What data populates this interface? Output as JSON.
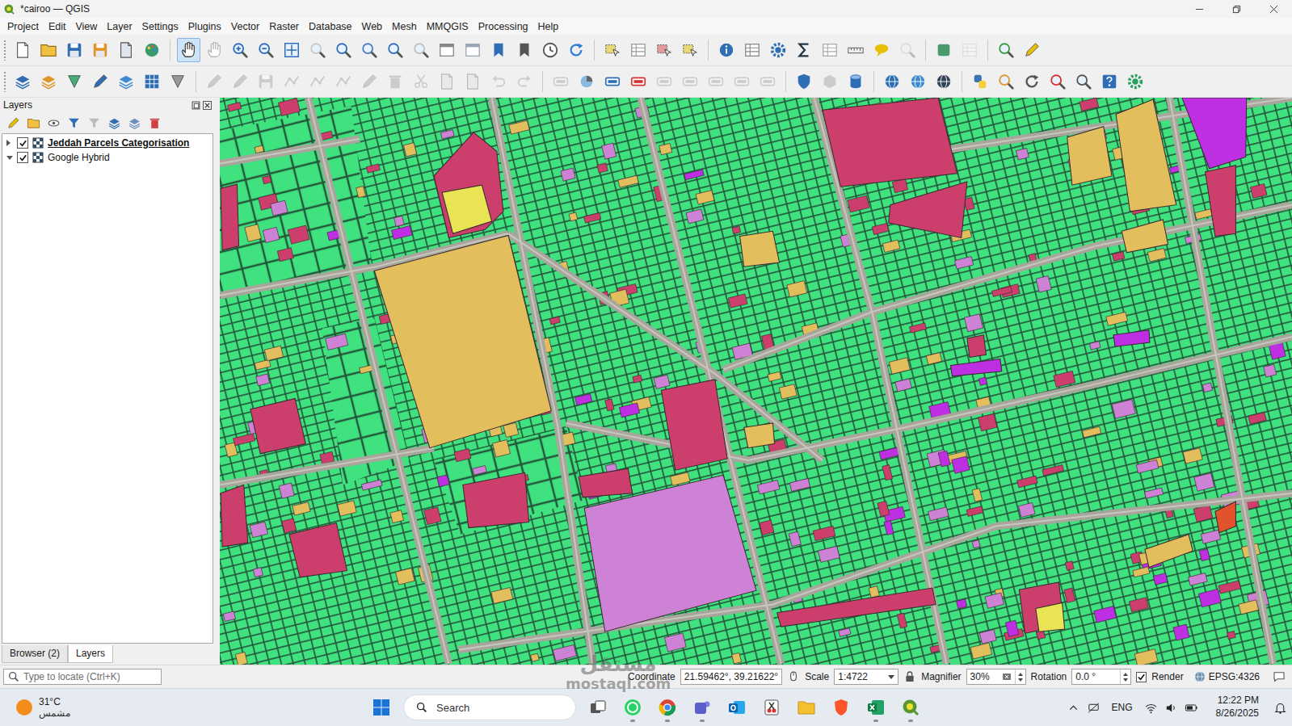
{
  "window": {
    "title": "*cairoo — QGIS"
  },
  "menu": [
    "Project",
    "Edit",
    "View",
    "Layer",
    "Settings",
    "Plugins",
    "Vector",
    "Raster",
    "Database",
    "Web",
    "Mesh",
    "MMQGIS",
    "Processing",
    "Help"
  ],
  "toolbars": [
    {
      "groups": [
        [
          {
            "kind": "new",
            "selected": false,
            "disabled": false
          },
          {
            "kind": "open",
            "selected": false,
            "disabled": false
          },
          {
            "kind": "save",
            "selected": false,
            "disabled": false
          },
          {
            "kind": "save-as",
            "selected": false,
            "disabled": false
          },
          {
            "kind": "layout",
            "selected": false,
            "disabled": false
          },
          {
            "kind": "style",
            "selected": false,
            "disabled": false
          }
        ],
        [
          {
            "kind": "pan",
            "selected": true,
            "disabled": false
          },
          {
            "kind": "pan-selection",
            "selected": false,
            "disabled": false
          },
          {
            "kind": "zoom-in",
            "selected": false,
            "disabled": false
          },
          {
            "kind": "zoom-out",
            "selected": false,
            "disabled": false
          },
          {
            "kind": "full-extent",
            "selected": false,
            "disabled": false
          },
          {
            "kind": "zoom-selection",
            "selected": false,
            "disabled": false
          },
          {
            "kind": "zoom-layer",
            "selected": false,
            "disabled": false
          },
          {
            "kind": "zoom-native",
            "selected": false,
            "disabled": false
          },
          {
            "kind": "zoom-last",
            "selected": false,
            "disabled": false
          },
          {
            "kind": "zoom-next",
            "selected": false,
            "disabled": false
          },
          {
            "kind": "map-view",
            "selected": false,
            "disabled": false
          },
          {
            "kind": "view-3d",
            "selected": false,
            "disabled": false
          },
          {
            "kind": "bookmark",
            "selected": false,
            "disabled": false
          },
          {
            "kind": "bookmarks",
            "selected": false,
            "disabled": false
          },
          {
            "kind": "temporal",
            "selected": false,
            "disabled": false
          },
          {
            "kind": "refresh",
            "selected": false,
            "disabled": false
          }
        ],
        [
          {
            "kind": "select",
            "selected": false,
            "disabled": false
          },
          {
            "kind": "select-value",
            "selected": false,
            "disabled": false
          },
          {
            "kind": "deselect",
            "selected": false,
            "disabled": false
          },
          {
            "kind": "select-location",
            "selected": false,
            "disabled": false
          }
        ],
        [
          {
            "kind": "identify",
            "selected": false,
            "disabled": false
          },
          {
            "kind": "attribute-table",
            "selected": false,
            "disabled": false
          },
          {
            "kind": "toolbox",
            "selected": false,
            "disabled": false
          },
          {
            "kind": "statistics",
            "selected": false,
            "disabled": false
          },
          {
            "kind": "field-calc",
            "selected": false,
            "disabled": false
          },
          {
            "kind": "measure",
            "selected": false,
            "disabled": false
          },
          {
            "kind": "tips",
            "selected": false,
            "disabled": false
          },
          {
            "kind": "locator",
            "selected": false,
            "disabled": true
          }
        ],
        [
          {
            "kind": "plugins",
            "selected": false,
            "disabled": false
          },
          {
            "kind": "metasearch",
            "selected": false,
            "disabled": true
          }
        ],
        [
          {
            "kind": "search",
            "selected": false,
            "disabled": false
          },
          {
            "kind": "brush",
            "selected": false,
            "disabled": false
          }
        ]
      ]
    },
    {
      "groups": [
        [
          {
            "kind": "data-source",
            "selected": false,
            "disabled": false
          },
          {
            "kind": "geopackage",
            "selected": false,
            "disabled": false
          },
          {
            "kind": "add-vector",
            "selected": false,
            "disabled": false
          },
          {
            "kind": "add-line",
            "selected": false,
            "disabled": false
          },
          {
            "kind": "add-wms",
            "selected": false,
            "disabled": false
          },
          {
            "kind": "add-raster",
            "selected": false,
            "disabled": false
          },
          {
            "kind": "add-virtual",
            "selected": false,
            "disabled": false
          }
        ],
        [
          {
            "kind": "edit-pencil",
            "selected": false,
            "disabled": true
          },
          {
            "kind": "toggle-edit",
            "selected": false,
            "disabled": true
          },
          {
            "kind": "save-edits",
            "selected": false,
            "disabled": true
          },
          {
            "kind": "digitize",
            "selected": false,
            "disabled": true
          },
          {
            "kind": "add-vertex",
            "selected": false,
            "disabled": true
          },
          {
            "kind": "vertex-tool",
            "selected": false,
            "disabled": true
          },
          {
            "kind": "modify",
            "selected": false,
            "disabled": true
          },
          {
            "kind": "delete",
            "selected": false,
            "disabled": true
          },
          {
            "kind": "cut",
            "selected": false,
            "disabled": true
          },
          {
            "kind": "copy",
            "selected": false,
            "disabled": true
          },
          {
            "kind": "paste",
            "selected": false,
            "disabled": true
          },
          {
            "kind": "undo",
            "selected": false,
            "disabled": true
          },
          {
            "kind": "redo",
            "selected": false,
            "disabled": true
          }
        ],
        [
          {
            "kind": "label-tool",
            "selected": false,
            "disabled": true
          },
          {
            "kind": "diagram",
            "selected": false,
            "disabled": false
          },
          {
            "kind": "label",
            "selected": false,
            "disabled": false
          },
          {
            "kind": "label-highlight",
            "selected": false,
            "disabled": false
          },
          {
            "kind": "pin",
            "selected": false,
            "disabled": true
          },
          {
            "kind": "show-hide",
            "selected": false,
            "disabled": true
          },
          {
            "kind": "move-label",
            "selected": false,
            "disabled": true
          },
          {
            "kind": "rotate-label",
            "selected": false,
            "disabled": true
          },
          {
            "kind": "change-label",
            "selected": false,
            "disabled": true
          }
        ],
        [
          {
            "kind": "shield",
            "selected": false,
            "disabled": false
          },
          {
            "kind": "cube",
            "selected": false,
            "disabled": true
          },
          {
            "kind": "database",
            "selected": false,
            "disabled": false
          }
        ],
        [
          {
            "kind": "globe",
            "selected": false,
            "disabled": false
          },
          {
            "kind": "globe-search",
            "selected": false,
            "disabled": false
          },
          {
            "kind": "globe-dark",
            "selected": false,
            "disabled": false
          }
        ],
        [
          {
            "kind": "python",
            "selected": false,
            "disabled": false
          },
          {
            "kind": "zoom-tool",
            "selected": false,
            "disabled": false
          },
          {
            "kind": "loop",
            "selected": false,
            "disabled": false
          },
          {
            "kind": "x-tool",
            "selected": false,
            "disabled": false
          },
          {
            "kind": "zoom-z",
            "selected": false,
            "disabled": false
          },
          {
            "kind": "help",
            "selected": false,
            "disabled": false
          },
          {
            "kind": "georef",
            "selected": false,
            "disabled": false
          }
        ]
      ]
    }
  ],
  "layers_panel": {
    "title": "Layers",
    "layers": [
      {
        "name": "Jeddah Parcels Categorisation",
        "checked": true,
        "expanded": false,
        "selected": true
      },
      {
        "name": "Google Hybrid",
        "checked": true,
        "expanded": true,
        "selected": false
      }
    ],
    "tabs": [
      {
        "label": "Browser (2)",
        "selected": false
      },
      {
        "label": "Layers",
        "selected": true
      }
    ]
  },
  "map": {
    "categories": [
      {
        "color": "#3fe27f"
      },
      {
        "color": "#e2be5c"
      },
      {
        "color": "#cc3e6b"
      },
      {
        "color": "#cd82d6"
      },
      {
        "color": "#be2ee3"
      },
      {
        "color": "#e9e453"
      },
      {
        "color": "#e2522c"
      }
    ]
  },
  "status_bar": {
    "locate_placeholder": "Type to locate (Ctrl+K)",
    "coordinate_label": "Coordinate",
    "coordinate": "21.59462°, 39.21622°",
    "scale_label": "Scale",
    "scale": "1:4722",
    "magnifier_label": "Magnifier",
    "magnifier": "30%",
    "rotation_label": "Rotation",
    "rotation": "0.0 °",
    "render_label": "Render",
    "render_checked": true,
    "crs": "EPSG:4326"
  },
  "taskbar": {
    "weather": {
      "temp": "31°C",
      "condition": "مشمس"
    },
    "search": "Search",
    "apps": [
      {
        "kind": "task-view",
        "running": false
      },
      {
        "kind": "whatsapp",
        "running": true
      },
      {
        "kind": "chrome",
        "running": true
      },
      {
        "kind": "teams",
        "running": true
      },
      {
        "kind": "outlook",
        "running": false
      },
      {
        "kind": "snipping",
        "running": false
      },
      {
        "kind": "explorer",
        "running": false
      },
      {
        "kind": "brave",
        "running": false
      },
      {
        "kind": "excel",
        "running": true
      },
      {
        "kind": "qgis",
        "running": true
      }
    ],
    "language": "ENG",
    "time": "12:22 PM",
    "date": "8/26/2025"
  },
  "watermark": {
    "logo": "مستقل",
    "site": "mostaql.com"
  }
}
